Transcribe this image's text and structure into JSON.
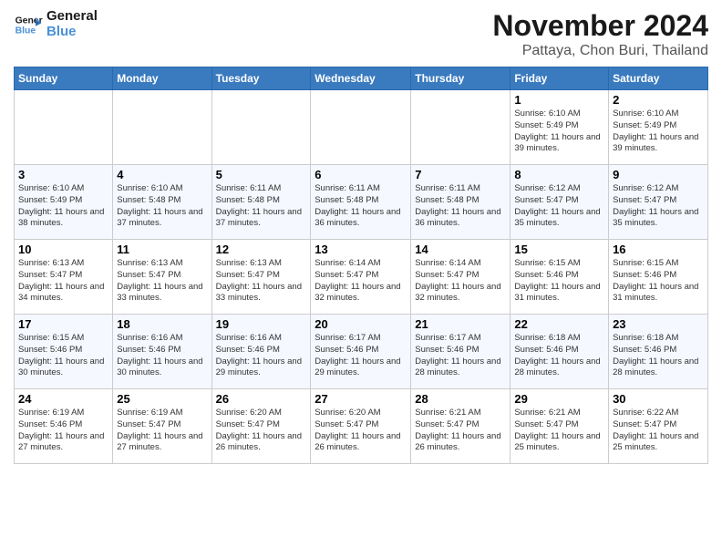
{
  "logo": {
    "line1": "General",
    "line2": "Blue"
  },
  "title": "November 2024",
  "location": "Pattaya, Chon Buri, Thailand",
  "days": [
    "Sunday",
    "Monday",
    "Tuesday",
    "Wednesday",
    "Thursday",
    "Friday",
    "Saturday"
  ],
  "weeks": [
    [
      {
        "date": "",
        "info": ""
      },
      {
        "date": "",
        "info": ""
      },
      {
        "date": "",
        "info": ""
      },
      {
        "date": "",
        "info": ""
      },
      {
        "date": "",
        "info": ""
      },
      {
        "date": "1",
        "info": "Sunrise: 6:10 AM\nSunset: 5:49 PM\nDaylight: 11 hours and 39 minutes."
      },
      {
        "date": "2",
        "info": "Sunrise: 6:10 AM\nSunset: 5:49 PM\nDaylight: 11 hours and 39 minutes."
      }
    ],
    [
      {
        "date": "3",
        "info": "Sunrise: 6:10 AM\nSunset: 5:49 PM\nDaylight: 11 hours and 38 minutes."
      },
      {
        "date": "4",
        "info": "Sunrise: 6:10 AM\nSunset: 5:48 PM\nDaylight: 11 hours and 37 minutes."
      },
      {
        "date": "5",
        "info": "Sunrise: 6:11 AM\nSunset: 5:48 PM\nDaylight: 11 hours and 37 minutes."
      },
      {
        "date": "6",
        "info": "Sunrise: 6:11 AM\nSunset: 5:48 PM\nDaylight: 11 hours and 36 minutes."
      },
      {
        "date": "7",
        "info": "Sunrise: 6:11 AM\nSunset: 5:48 PM\nDaylight: 11 hours and 36 minutes."
      },
      {
        "date": "8",
        "info": "Sunrise: 6:12 AM\nSunset: 5:47 PM\nDaylight: 11 hours and 35 minutes."
      },
      {
        "date": "9",
        "info": "Sunrise: 6:12 AM\nSunset: 5:47 PM\nDaylight: 11 hours and 35 minutes."
      }
    ],
    [
      {
        "date": "10",
        "info": "Sunrise: 6:13 AM\nSunset: 5:47 PM\nDaylight: 11 hours and 34 minutes."
      },
      {
        "date": "11",
        "info": "Sunrise: 6:13 AM\nSunset: 5:47 PM\nDaylight: 11 hours and 33 minutes."
      },
      {
        "date": "12",
        "info": "Sunrise: 6:13 AM\nSunset: 5:47 PM\nDaylight: 11 hours and 33 minutes."
      },
      {
        "date": "13",
        "info": "Sunrise: 6:14 AM\nSunset: 5:47 PM\nDaylight: 11 hours and 32 minutes."
      },
      {
        "date": "14",
        "info": "Sunrise: 6:14 AM\nSunset: 5:47 PM\nDaylight: 11 hours and 32 minutes."
      },
      {
        "date": "15",
        "info": "Sunrise: 6:15 AM\nSunset: 5:46 PM\nDaylight: 11 hours and 31 minutes."
      },
      {
        "date": "16",
        "info": "Sunrise: 6:15 AM\nSunset: 5:46 PM\nDaylight: 11 hours and 31 minutes."
      }
    ],
    [
      {
        "date": "17",
        "info": "Sunrise: 6:15 AM\nSunset: 5:46 PM\nDaylight: 11 hours and 30 minutes."
      },
      {
        "date": "18",
        "info": "Sunrise: 6:16 AM\nSunset: 5:46 PM\nDaylight: 11 hours and 30 minutes."
      },
      {
        "date": "19",
        "info": "Sunrise: 6:16 AM\nSunset: 5:46 PM\nDaylight: 11 hours and 29 minutes."
      },
      {
        "date": "20",
        "info": "Sunrise: 6:17 AM\nSunset: 5:46 PM\nDaylight: 11 hours and 29 minutes."
      },
      {
        "date": "21",
        "info": "Sunrise: 6:17 AM\nSunset: 5:46 PM\nDaylight: 11 hours and 28 minutes."
      },
      {
        "date": "22",
        "info": "Sunrise: 6:18 AM\nSunset: 5:46 PM\nDaylight: 11 hours and 28 minutes."
      },
      {
        "date": "23",
        "info": "Sunrise: 6:18 AM\nSunset: 5:46 PM\nDaylight: 11 hours and 28 minutes."
      }
    ],
    [
      {
        "date": "24",
        "info": "Sunrise: 6:19 AM\nSunset: 5:46 PM\nDaylight: 11 hours and 27 minutes."
      },
      {
        "date": "25",
        "info": "Sunrise: 6:19 AM\nSunset: 5:47 PM\nDaylight: 11 hours and 27 minutes."
      },
      {
        "date": "26",
        "info": "Sunrise: 6:20 AM\nSunset: 5:47 PM\nDaylight: 11 hours and 26 minutes."
      },
      {
        "date": "27",
        "info": "Sunrise: 6:20 AM\nSunset: 5:47 PM\nDaylight: 11 hours and 26 minutes."
      },
      {
        "date": "28",
        "info": "Sunrise: 6:21 AM\nSunset: 5:47 PM\nDaylight: 11 hours and 26 minutes."
      },
      {
        "date": "29",
        "info": "Sunrise: 6:21 AM\nSunset: 5:47 PM\nDaylight: 11 hours and 25 minutes."
      },
      {
        "date": "30",
        "info": "Sunrise: 6:22 AM\nSunset: 5:47 PM\nDaylight: 11 hours and 25 minutes."
      }
    ]
  ]
}
